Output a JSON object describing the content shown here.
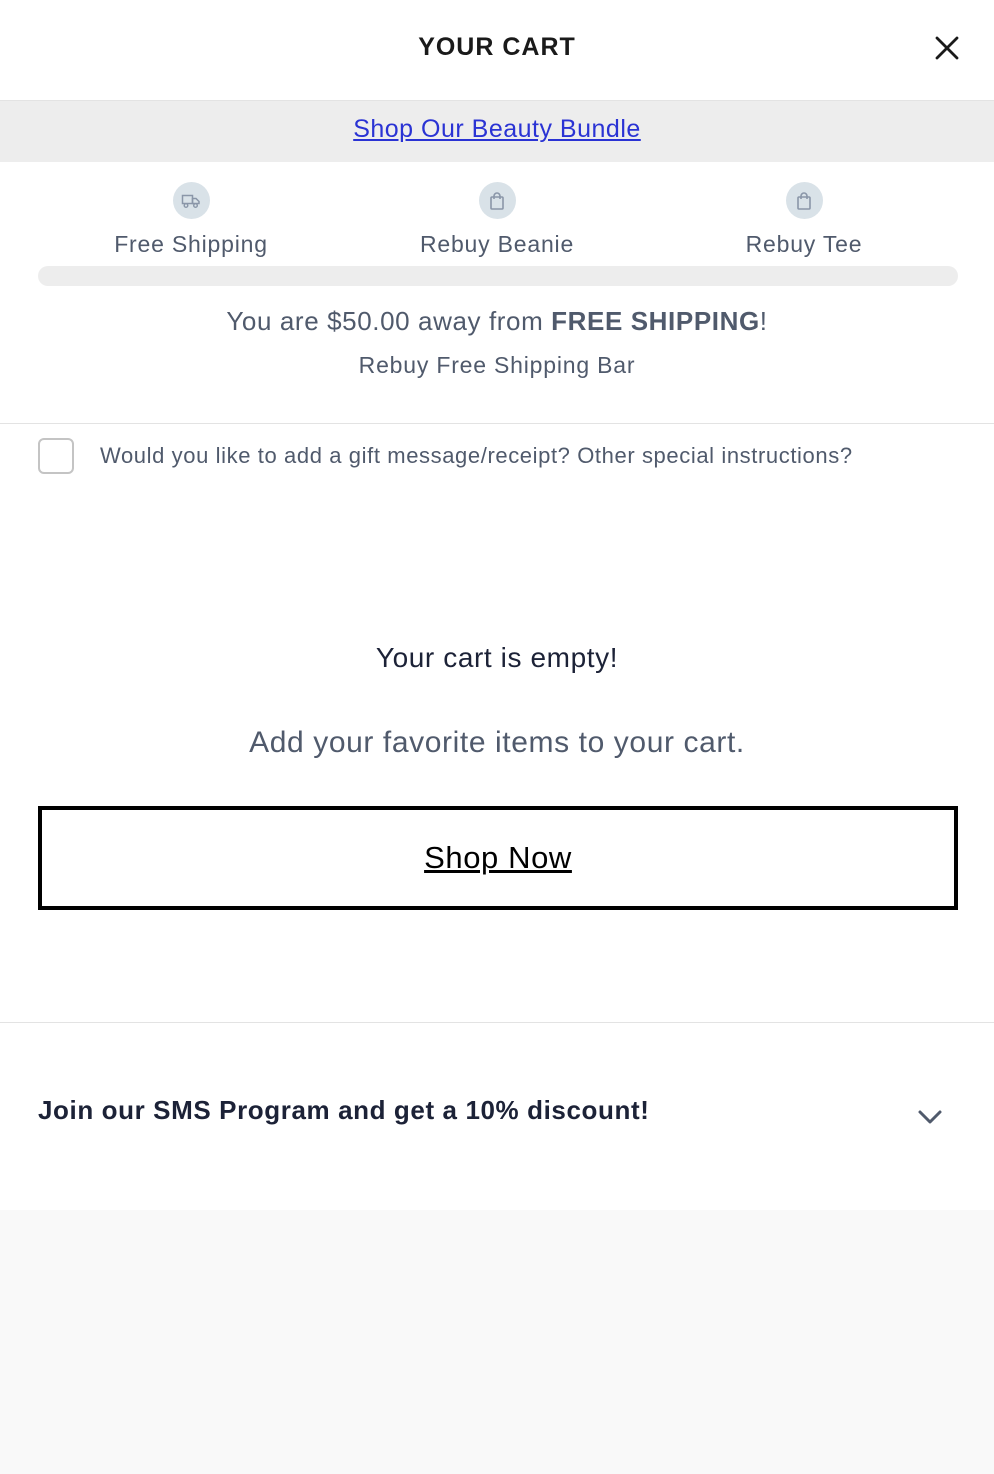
{
  "header": {
    "title": "YOUR CART",
    "close_icon": "close-icon"
  },
  "announcement": {
    "link_text": "Shop Our Beauty Bundle",
    "link_color": "#2a33d4"
  },
  "tiers": {
    "items": [
      {
        "label": "Free Shipping",
        "icon": "truck-icon"
      },
      {
        "label": "Rebuy Beanie",
        "icon": "shopping-bag-icon"
      },
      {
        "label": "Rebuy Tee",
        "icon": "shopping-bag-icon"
      }
    ],
    "progress": 0,
    "message_prefix": "You are $50.00 away from ",
    "message_bold": "FREE SHIPPING",
    "message_suffix": "!",
    "subtitle": "Rebuy Free Shipping Bar"
  },
  "gift": {
    "label": "Would you like to add a gift message/receipt? Other special instructions?",
    "checked": false
  },
  "empty_cart": {
    "title": "Your cart is empty!",
    "subtitle": "Add your favorite items to your cart.",
    "button_label": "Shop Now"
  },
  "sms": {
    "label": "Join our SMS Program and get a 10% discount!",
    "icon": "chevron-down-icon"
  },
  "colors": {
    "text_primary": "#1c2237",
    "text_secondary": "#505a6c",
    "icon_bg": "#d9e2e8",
    "divider": "#e3e3e3"
  }
}
